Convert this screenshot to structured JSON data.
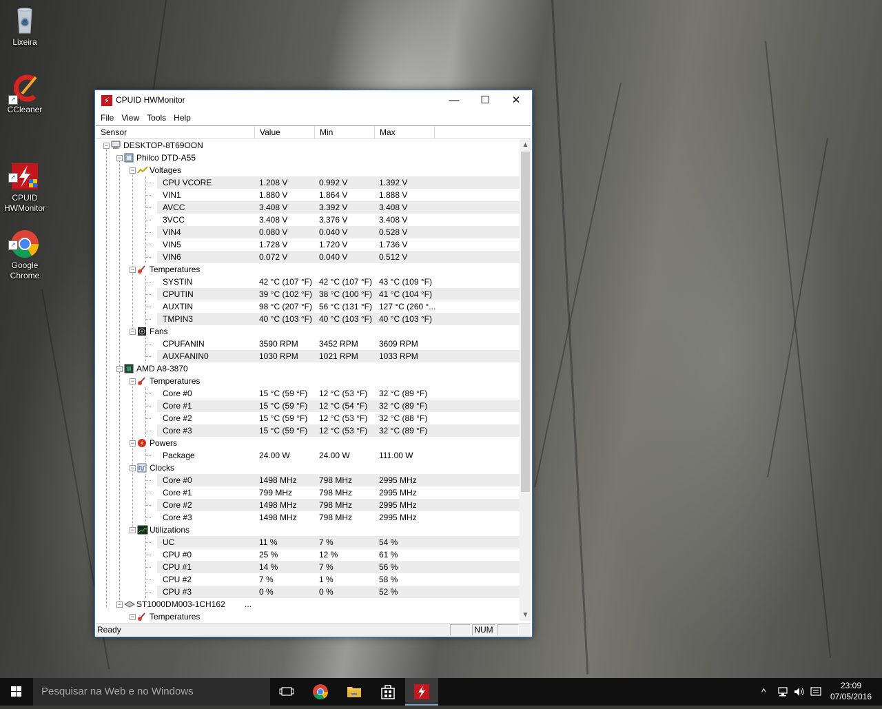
{
  "desktop": {
    "icons": [
      {
        "label": "Lixeira",
        "icon": "recycle-bin-icon"
      },
      {
        "label": "CCleaner",
        "icon": "ccleaner-icon"
      },
      {
        "label": "CPUID\nHWMonitor",
        "icon": "hwmonitor-icon"
      },
      {
        "label": "Google\nChrome",
        "icon": "chrome-icon"
      }
    ]
  },
  "window": {
    "title": "CPUID HWMonitor",
    "controls": {
      "minimize": "—",
      "maximize": "☐",
      "close": "✕"
    },
    "menu": [
      "File",
      "View",
      "Tools",
      "Help"
    ],
    "columns": [
      "Sensor",
      "Value",
      "Min",
      "Max"
    ],
    "rows": [
      {
        "level": 0,
        "type": "computer",
        "sensor": "DESKTOP-8T69OON",
        "expand": "−"
      },
      {
        "level": 1,
        "type": "board",
        "sensor": "Philco DTD-A55",
        "expand": "−"
      },
      {
        "level": 2,
        "type": "voltage",
        "sensor": "Voltages",
        "expand": "−"
      },
      {
        "level": 3,
        "sensor": "CPU VCORE",
        "value": "1.208 V",
        "min": "0.992 V",
        "max": "1.392 V"
      },
      {
        "level": 3,
        "sensor": "VIN1",
        "value": "1.880 V",
        "min": "1.864 V",
        "max": "1.888 V"
      },
      {
        "level": 3,
        "sensor": "AVCC",
        "value": "3.408 V",
        "min": "3.392 V",
        "max": "3.408 V"
      },
      {
        "level": 3,
        "sensor": "3VCC",
        "value": "3.408 V",
        "min": "3.376 V",
        "max": "3.408 V"
      },
      {
        "level": 3,
        "sensor": "VIN4",
        "value": "0.080 V",
        "min": "0.040 V",
        "max": "0.528 V"
      },
      {
        "level": 3,
        "sensor": "VIN5",
        "value": "1.728 V",
        "min": "1.720 V",
        "max": "1.736 V"
      },
      {
        "level": 3,
        "sensor": "VIN6",
        "value": "0.072 V",
        "min": "0.040 V",
        "max": "0.512 V"
      },
      {
        "level": 2,
        "type": "temperature",
        "sensor": "Temperatures",
        "expand": "−"
      },
      {
        "level": 3,
        "sensor": "SYSTIN",
        "value": "42 °C  (107 °F)",
        "min": "42 °C  (107 °F)",
        "max": "43 °C  (109 °F)"
      },
      {
        "level": 3,
        "sensor": "CPUTIN",
        "value": "39 °C  (102 °F)",
        "min": "38 °C  (100 °F)",
        "max": "41 °C  (104 °F)"
      },
      {
        "level": 3,
        "sensor": "AUXTIN",
        "value": "98 °C  (207 °F)",
        "min": "56 °C  (131 °F)",
        "max": "127 °C  (260 °..."
      },
      {
        "level": 3,
        "sensor": "TMPIN3",
        "value": "40 °C  (103 °F)",
        "min": "40 °C  (103 °F)",
        "max": "40 °C  (103 °F)"
      },
      {
        "level": 2,
        "type": "fan",
        "sensor": "Fans",
        "expand": "−"
      },
      {
        "level": 3,
        "sensor": "CPUFANIN",
        "value": "3590 RPM",
        "min": "3452 RPM",
        "max": "3609 RPM"
      },
      {
        "level": 3,
        "sensor": "AUXFANIN0",
        "value": "1030 RPM",
        "min": "1021 RPM",
        "max": "1033 RPM"
      },
      {
        "level": 1,
        "type": "cpu",
        "sensor": "AMD A8-3870",
        "expand": "−"
      },
      {
        "level": 2,
        "type": "temperature",
        "sensor": "Temperatures",
        "expand": "−"
      },
      {
        "level": 3,
        "sensor": "Core #0",
        "value": "15 °C  (59 °F)",
        "min": "12 °C  (53 °F)",
        "max": "32 °C  (89 °F)"
      },
      {
        "level": 3,
        "sensor": "Core #1",
        "value": "15 °C  (59 °F)",
        "min": "12 °C  (54 °F)",
        "max": "32 °C  (89 °F)"
      },
      {
        "level": 3,
        "sensor": "Core #2",
        "value": "15 °C  (59 °F)",
        "min": "12 °C  (53 °F)",
        "max": "32 °C  (88 °F)"
      },
      {
        "level": 3,
        "sensor": "Core #3",
        "value": "15 °C  (59 °F)",
        "min": "12 °C  (53 °F)",
        "max": "32 °C  (89 °F)"
      },
      {
        "level": 2,
        "type": "power",
        "sensor": "Powers",
        "expand": "−"
      },
      {
        "level": 3,
        "sensor": "Package",
        "value": "24.00 W",
        "min": "24.00 W",
        "max": "111.00 W"
      },
      {
        "level": 2,
        "type": "clock",
        "sensor": "Clocks",
        "expand": "−"
      },
      {
        "level": 3,
        "sensor": "Core #0",
        "value": "1498 MHz",
        "min": "798 MHz",
        "max": "2995 MHz"
      },
      {
        "level": 3,
        "sensor": "Core #1",
        "value": "799 MHz",
        "min": "798 MHz",
        "max": "2995 MHz"
      },
      {
        "level": 3,
        "sensor": "Core #2",
        "value": "1498 MHz",
        "min": "798 MHz",
        "max": "2995 MHz"
      },
      {
        "level": 3,
        "sensor": "Core #3",
        "value": "1498 MHz",
        "min": "798 MHz",
        "max": "2995 MHz"
      },
      {
        "level": 2,
        "type": "utilization",
        "sensor": "Utilizations",
        "expand": "−"
      },
      {
        "level": 3,
        "sensor": "UC",
        "value": "11 %",
        "min": "7 %",
        "max": "54 %"
      },
      {
        "level": 3,
        "sensor": "CPU #0",
        "value": "25 %",
        "min": "12 %",
        "max": "61 %"
      },
      {
        "level": 3,
        "sensor": "CPU #1",
        "value": "14 %",
        "min": "7 %",
        "max": "56 %"
      },
      {
        "level": 3,
        "sensor": "CPU #2",
        "value": "7 %",
        "min": "1 %",
        "max": "58 %"
      },
      {
        "level": 3,
        "sensor": "CPU #3",
        "value": "0 %",
        "min": "0 %",
        "max": "52 %"
      },
      {
        "level": 1,
        "type": "disk",
        "sensor": "ST1000DM003-1CH162",
        "extra": "...",
        "expand": "−"
      },
      {
        "level": 2,
        "type": "temperature",
        "sensor": "Temperatures",
        "expand": "−"
      }
    ],
    "status": {
      "text": "Ready",
      "num": "NUM"
    }
  },
  "taskbar": {
    "search_placeholder": "Pesquisar na Web e no Windows",
    "time": "23:09",
    "date": "07/05/2016",
    "colors": {
      "background": "#101010",
      "accent": "#7a9ed6"
    }
  }
}
